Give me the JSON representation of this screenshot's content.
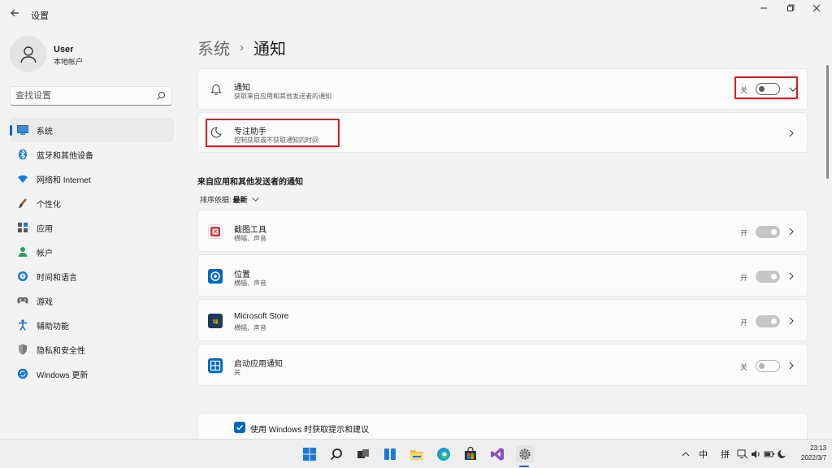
{
  "window": {
    "title": "设置",
    "back_icon": "arrow-left-icon",
    "minimize_icon": "minimize-icon",
    "maximize_icon": "restore-icon",
    "close_icon": "close-icon"
  },
  "profile": {
    "name": "User",
    "subtitle": "本地帐户"
  },
  "search": {
    "placeholder": "查找设置"
  },
  "sidebar": {
    "items": [
      {
        "label": "系统",
        "icon": "monitor-icon",
        "active": true
      },
      {
        "label": "蓝牙和其他设备",
        "icon": "bluetooth-icon"
      },
      {
        "label": "网络和 Internet",
        "icon": "wifi-icon"
      },
      {
        "label": "个性化",
        "icon": "brush-icon"
      },
      {
        "label": "应用",
        "icon": "apps-icon"
      },
      {
        "label": "帐户",
        "icon": "person-icon"
      },
      {
        "label": "时间和语言",
        "icon": "globe-clock-icon"
      },
      {
        "label": "游戏",
        "icon": "gamepad-icon"
      },
      {
        "label": "辅助功能",
        "icon": "accessibility-icon"
      },
      {
        "label": "隐私和安全性",
        "icon": "shield-icon"
      },
      {
        "label": "Windows 更新",
        "icon": "update-icon"
      }
    ]
  },
  "breadcrumb": {
    "parent": "系统",
    "separator": "›",
    "current": "通知"
  },
  "notifications_card": {
    "title": "通知",
    "subtitle": "获取来自应用和其他发送者的通知",
    "toggle_label": "关",
    "toggle_on": false
  },
  "focus_card": {
    "title": "专注助手",
    "subtitle": "控制获取或不获取通知的时间"
  },
  "section": {
    "title": "来自应用和其他发送者的通知",
    "sort_label": "排序依据:",
    "sort_value": "最新"
  },
  "apps": [
    {
      "name": "截图工具",
      "sub": "横幅、声音",
      "toggle_label": "开",
      "on": true,
      "color": "#d13438"
    },
    {
      "name": "位置",
      "sub": "横幅、声音",
      "toggle_label": "开",
      "on": true,
      "color": "#0067c0"
    },
    {
      "name": "Microsoft Store",
      "sub": "横幅、声音",
      "toggle_label": "开",
      "on": true,
      "color": "#1a3a5c"
    },
    {
      "name": "启动应用通知",
      "sub": "关",
      "toggle_label": "关",
      "on": false,
      "color": "#0067c0"
    }
  ],
  "tips": {
    "label": "使用 Windows 时获取提示和建议",
    "checked": true
  },
  "taskbar": {
    "ime_lang": "中",
    "ime_mode": "拼",
    "time": "23:13",
    "date": "2022/3/7"
  },
  "colors": {
    "accent": "#0067c0",
    "highlight": "#e0191b"
  }
}
